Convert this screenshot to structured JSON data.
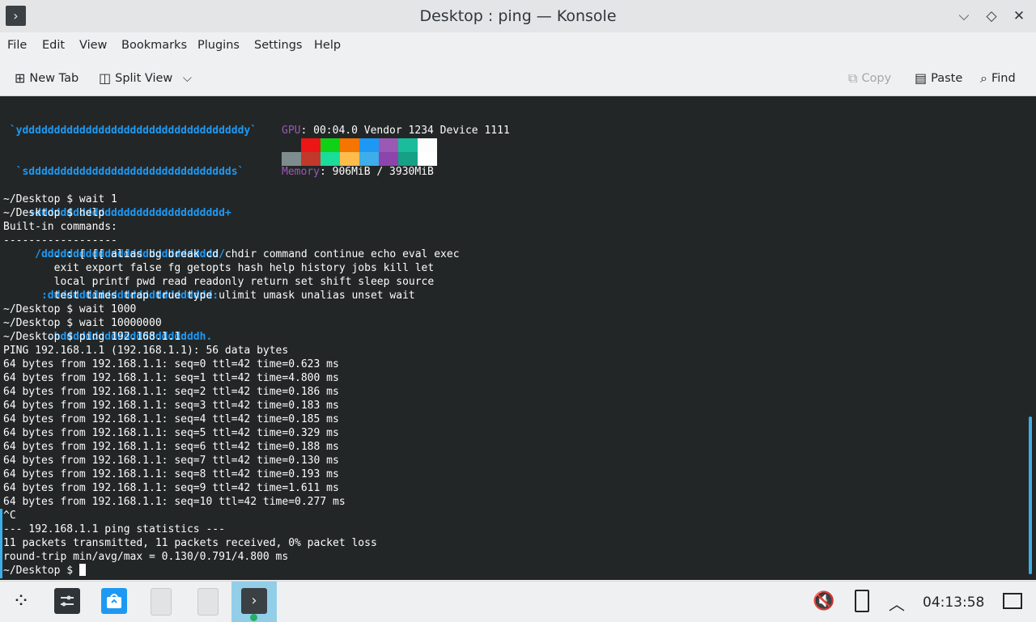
{
  "window": {
    "title": "Desktop : ping — Konsole",
    "app_icon": "terminal-app-icon",
    "controls": [
      "chevron-down-icon",
      "diamond-icon",
      "close-icon"
    ]
  },
  "menubar": {
    "items": [
      "File",
      "Edit",
      "View",
      "Bookmarks",
      "Plugins",
      "Settings",
      "Help"
    ]
  },
  "toolbar": {
    "new_tab": "New Tab",
    "split_view": "Split View",
    "copy": "Copy",
    "paste": "Paste",
    "find": "Find"
  },
  "neofetch": {
    "logo_lines": [
      " `ydddddddddddddddddddddddddddddddddddy`",
      "  `sdddddddddddddddddddddddddddddddds`",
      "    +dddddddddddddddddddddddddddddd+",
      "     /dddddddddddddddddddddddddddd/",
      "      :dddddddddddddddddddddddddd:",
      "       .hddddddddddddddddddddddh."
    ],
    "gpu_key": "GPU",
    "gpu_value": ": 00:04.0 Vendor 1234 Device 1111",
    "memory_key": "Memory",
    "memory_value": ": 906MiB / 3930MiB",
    "palette_top": [
      "#232627",
      "#ed1515",
      "#11d116",
      "#f67400",
      "#1d99f3",
      "#9b59b6",
      "#1abc9c",
      "#fcfcfc"
    ],
    "palette_bottom": [
      "#7f8c8d",
      "#c0392b",
      "#1cdc9a",
      "#fdbc4b",
      "#3daee9",
      "#8e44ad",
      "#16a085",
      "#ffffff"
    ]
  },
  "terminal": {
    "lines": [
      "~/Desktop $ wait 1",
      "~/Desktop $ help",
      "Built-in commands:",
      "------------------",
      "        . : [ [[ alias bg break cd chdir command continue echo eval exec",
      "        exit export false fg getopts hash help history jobs kill let",
      "        local printf pwd read readonly return set shift sleep source",
      "        test times trap true type ulimit umask unalias unset wait",
      "~/Desktop $ wait 1000",
      "~/Desktop $ wait 10000000",
      "~/Desktop $ ping 192.168.1.1",
      "PING 192.168.1.1 (192.168.1.1): 56 data bytes",
      "64 bytes from 192.168.1.1: seq=0 ttl=42 time=0.623 ms",
      "64 bytes from 192.168.1.1: seq=1 ttl=42 time=4.800 ms",
      "64 bytes from 192.168.1.1: seq=2 ttl=42 time=0.186 ms",
      "64 bytes from 192.168.1.1: seq=3 ttl=42 time=0.183 ms",
      "64 bytes from 192.168.1.1: seq=4 ttl=42 time=0.185 ms",
      "64 bytes from 192.168.1.1: seq=5 ttl=42 time=0.329 ms",
      "64 bytes from 192.168.1.1: seq=6 ttl=42 time=0.188 ms",
      "64 bytes from 192.168.1.1: seq=7 ttl=42 time=0.130 ms",
      "64 bytes from 192.168.1.1: seq=8 ttl=42 time=0.193 ms",
      "64 bytes from 192.168.1.1: seq=9 ttl=42 time=1.611 ms",
      "64 bytes from 192.168.1.1: seq=10 ttl=42 time=0.277 ms",
      "^C",
      "--- 192.168.1.1 ping statistics ---",
      "11 packets transmitted, 11 packets received, 0% packet loss",
      "round-trip min/avg/max = 0.130/0.791/4.800 ms"
    ],
    "prompt": "~/Desktop $ "
  },
  "taskbar": {
    "icons": [
      "app-launcher-icon",
      "system-settings-icon",
      "discover-icon",
      "file-icon",
      "file-icon",
      "konsole-icon"
    ],
    "tray_icons": [
      "volume-muted-icon",
      "usb-drive-icon",
      "tray-expand-icon"
    ],
    "clock": "04:13:58",
    "show_desktop_icon": "show-desktop-icon"
  }
}
